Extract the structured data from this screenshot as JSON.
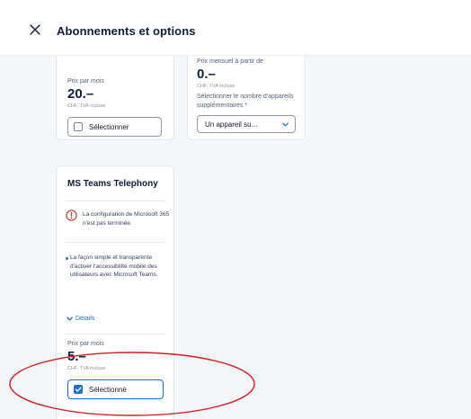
{
  "header": {
    "title": "Abonnements et options",
    "close_icon": "close-icon"
  },
  "card_a": {
    "price_label": "Prix par mois",
    "price": "20.–",
    "vat": "CHF, TVA incluse",
    "select_label": "Sélectionner",
    "selected": false
  },
  "card_b": {
    "price_label": "Prix mensuel à partir de",
    "price": "0.–",
    "vat": "CHF, TVA incluse",
    "devices_label": "Sélectionner le nombre d'appareils supplémentaires *",
    "dropdown_value": "Un appareil su..."
  },
  "card_teams": {
    "title": "MS Teams Telephony",
    "warning": "La configuration de Microsoft 365 n'est pas terminée.",
    "feature": "La façon simple et transparente d'activer l'accessibilité mobile des utilisateurs avec Microsoft Teams.",
    "details_label": "Détails",
    "price_label": "Prix par mois",
    "price": "5.–",
    "vat": "CHF, TVA incluse",
    "select_label": "Sélectionné",
    "selected": true
  },
  "colors": {
    "accent": "#1f6fd1",
    "warning": "#d23b2a",
    "annotation": "#d81b1b",
    "background": "#f3f6fa"
  }
}
